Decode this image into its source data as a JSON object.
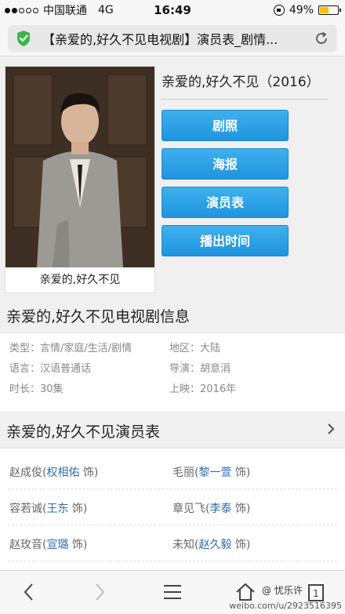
{
  "status_bar": {
    "carrier": "中国联通",
    "network": "4G",
    "time": "16:49",
    "battery": "49%",
    "battery_level": 0.49,
    "signal_filled": 2,
    "signal_total": 5
  },
  "address_bar": {
    "title": "【亲爱的,好久不见电视剧】演员表_剧情..."
  },
  "show": {
    "title": "亲爱的,好久不见（2016）",
    "poster_caption": "亲爱的,好久不见",
    "buttons": [
      "剧照",
      "海报",
      "演员表",
      "播出时间"
    ]
  },
  "info_section": {
    "heading": "亲爱的,好久不见电视剧信息",
    "items": [
      {
        "label": "类型：",
        "value": "言情/家庭/生活/剧情"
      },
      {
        "label": "地区：",
        "value": "大陆"
      },
      {
        "label": "语言：",
        "value": "汉语普通话"
      },
      {
        "label": "导演：",
        "value": "胡意涓"
      },
      {
        "label": "时长：",
        "value": "30集"
      },
      {
        "label": "上映：",
        "value": "2016年"
      }
    ]
  },
  "cast_section": {
    "heading": "亲爱的,好久不见演员表",
    "rows": [
      [
        {
          "role": "赵成俊(",
          "actor": "权相佑",
          "suffix": " 饰)"
        },
        {
          "role": "毛丽(",
          "actor": "黎一萱",
          "suffix": " 饰)"
        }
      ],
      [
        {
          "role": "容若诚(",
          "actor": "王东",
          "suffix": " 饰)"
        },
        {
          "role": "章见飞(",
          "actor": "李泰",
          "suffix": " 饰)"
        }
      ],
      [
        {
          "role": "赵玫音(",
          "actor": "宣璐",
          "suffix": " 饰)"
        },
        {
          "role": "未知(",
          "actor": "赵久毅",
          "suffix": " 饰)"
        }
      ]
    ]
  },
  "watermark": {
    "top": "@ 忧乐许",
    "url": "weibo.com/u/2923516395"
  },
  "colors": {
    "button": "#2aa0e6",
    "link": "#2a6fb0",
    "shield": "#3cb54a"
  }
}
